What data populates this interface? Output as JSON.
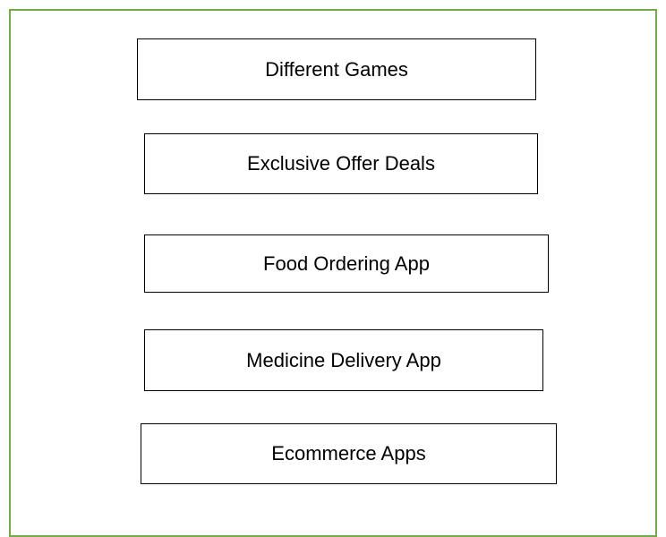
{
  "frame_color": "#70ad47",
  "boxes": [
    {
      "label": "Different Games"
    },
    {
      "label": "Exclusive Offer Deals"
    },
    {
      "label": "Food Ordering App"
    },
    {
      "label": "Medicine Delivery App"
    },
    {
      "label": "Ecommerce Apps"
    }
  ]
}
